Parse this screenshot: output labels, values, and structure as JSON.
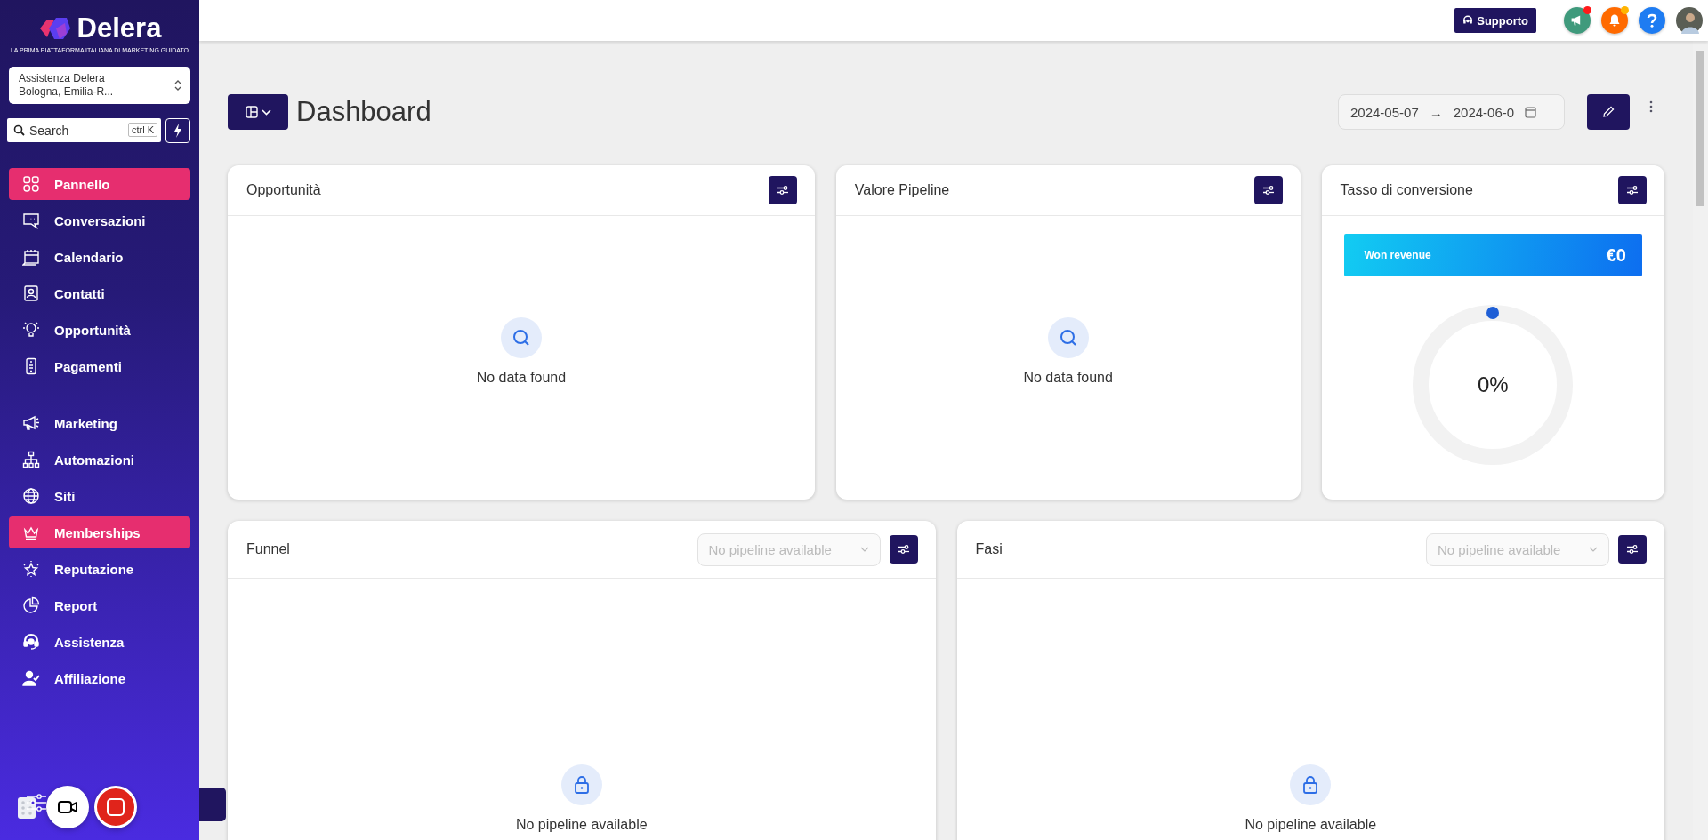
{
  "brand": {
    "name": "Delera",
    "tagline": "LA PRIMA PIATTAFORMA ITALIANA DI MARKETING GUIDATO"
  },
  "account": {
    "name": "Assistenza Delera",
    "location": "Bologna, Emilia-R..."
  },
  "search": {
    "placeholder": "Search",
    "shortcut": "ctrl K"
  },
  "nav": {
    "main": [
      {
        "label": "Pannello",
        "selected": true
      },
      {
        "label": "Conversazioni",
        "selected": false
      },
      {
        "label": "Calendario",
        "selected": false
      },
      {
        "label": "Contatti",
        "selected": false
      },
      {
        "label": "Opportunità",
        "selected": false
      },
      {
        "label": "Pagamenti",
        "selected": false
      }
    ],
    "secondary": [
      {
        "label": "Marketing",
        "selected": false
      },
      {
        "label": "Automazioni",
        "selected": false
      },
      {
        "label": "Siti",
        "selected": false
      },
      {
        "label": "Memberships",
        "selected": true
      },
      {
        "label": "Reputazione",
        "selected": false
      },
      {
        "label": "Report",
        "selected": false
      },
      {
        "label": "Assistenza",
        "selected": false
      },
      {
        "label": "Affiliazione",
        "selected": false
      }
    ]
  },
  "header": {
    "support": "Supporto",
    "icons": [
      {
        "kind": "announcements",
        "unread": true
      },
      {
        "kind": "notifications",
        "unread": true
      },
      {
        "kind": "help",
        "unread": false
      }
    ]
  },
  "page": {
    "title": "Dashboard",
    "date_from": "2024-05-07",
    "date_arrow": "→",
    "date_to": "2024-06-0"
  },
  "rows": [
    [
      {
        "kind": "empty",
        "title": "Opportunità",
        "message": "No data found"
      },
      {
        "kind": "empty",
        "title": "Valore Pipeline",
        "message": "No data found"
      },
      {
        "kind": "conversion",
        "title": "Tasso di conversione",
        "revenue_label": "Won revenue",
        "revenue_value": "€0",
        "reading": "0%"
      }
    ],
    [
      {
        "kind": "pipeline",
        "title": "Funnel",
        "select_placeholder": "No pipeline available",
        "message": "No pipeline available"
      },
      {
        "kind": "pipeline",
        "title": "Fasi",
        "select_placeholder": "No pipeline available",
        "message": "No pipeline available"
      }
    ]
  ]
}
